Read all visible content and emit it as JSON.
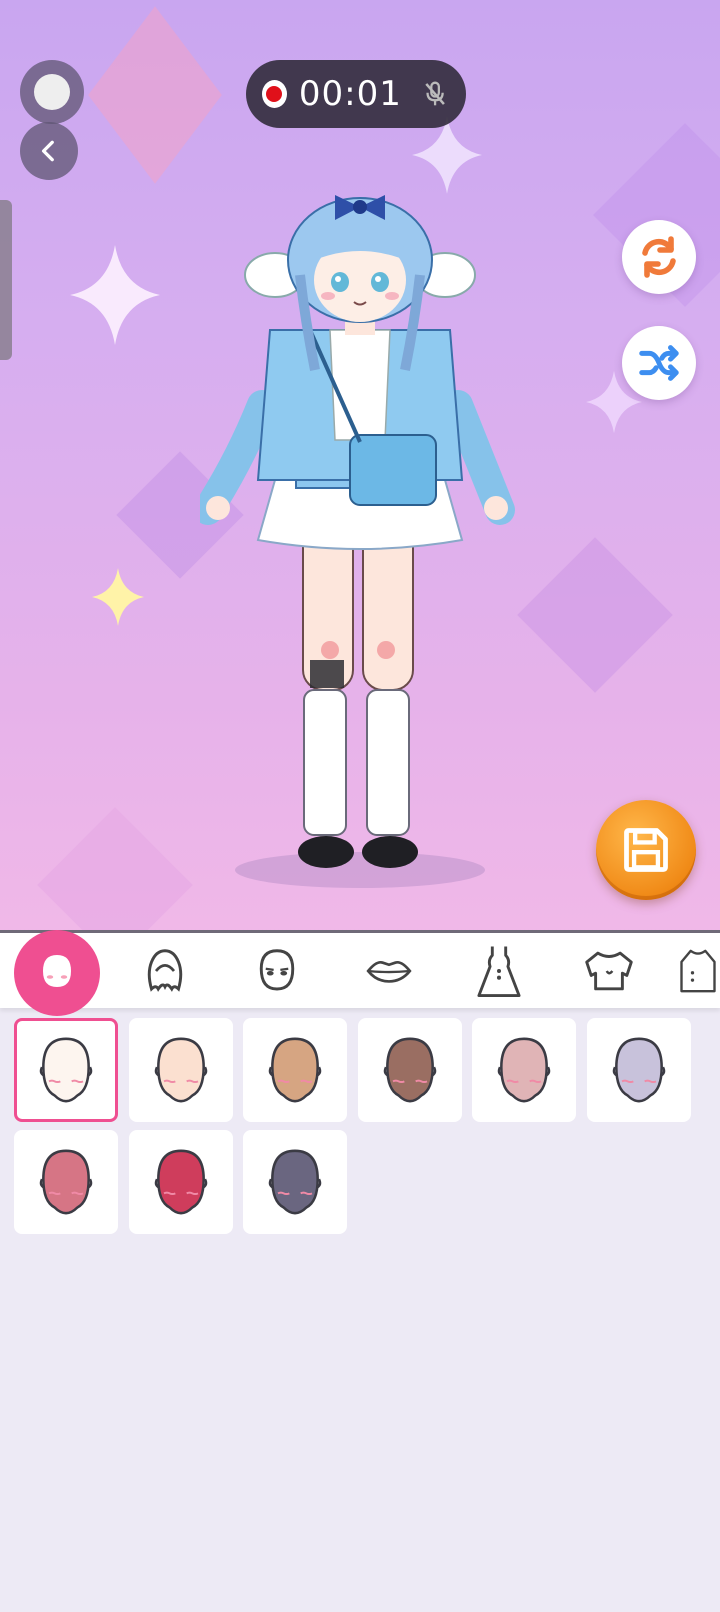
{
  "recording": {
    "time": "00:01",
    "mic_state": "muted"
  },
  "icons": {
    "record": "record-dot-icon",
    "back": "chevron-left-icon",
    "mic": "mic-off-icon",
    "reset": "refresh-icon",
    "random": "shuffle-icon",
    "save": "floppy-disk-icon"
  },
  "categories": [
    {
      "id": "skin",
      "icon": "face-skin-icon",
      "active": true
    },
    {
      "id": "hair",
      "icon": "hair-icon",
      "active": false
    },
    {
      "id": "face",
      "icon": "face-icon",
      "active": false
    },
    {
      "id": "mouth",
      "icon": "lips-icon",
      "active": false
    },
    {
      "id": "dress",
      "icon": "dress-icon",
      "active": false
    },
    {
      "id": "top",
      "icon": "top-icon",
      "active": false
    },
    {
      "id": "outerwear",
      "icon": "coat-icon",
      "active": false
    }
  ],
  "skin_tones": [
    {
      "color": "#fdf5ef",
      "selected": true
    },
    {
      "color": "#fbe0d0",
      "selected": false
    },
    {
      "color": "#d6a582",
      "selected": false
    },
    {
      "color": "#9a6e62",
      "selected": false
    },
    {
      "color": "#e0b4b6",
      "selected": false
    },
    {
      "color": "#c8c2db",
      "selected": false
    },
    {
      "color": "#d67585",
      "selected": false
    },
    {
      "color": "#cf3d5c",
      "selected": false
    },
    {
      "color": "#6a6680",
      "selected": false
    }
  ],
  "colors": {
    "accent": "#ef4f91",
    "save": "#f08a17",
    "reset_icon": "#f07a3a",
    "shuffle_icon": "#3d8ef0"
  }
}
